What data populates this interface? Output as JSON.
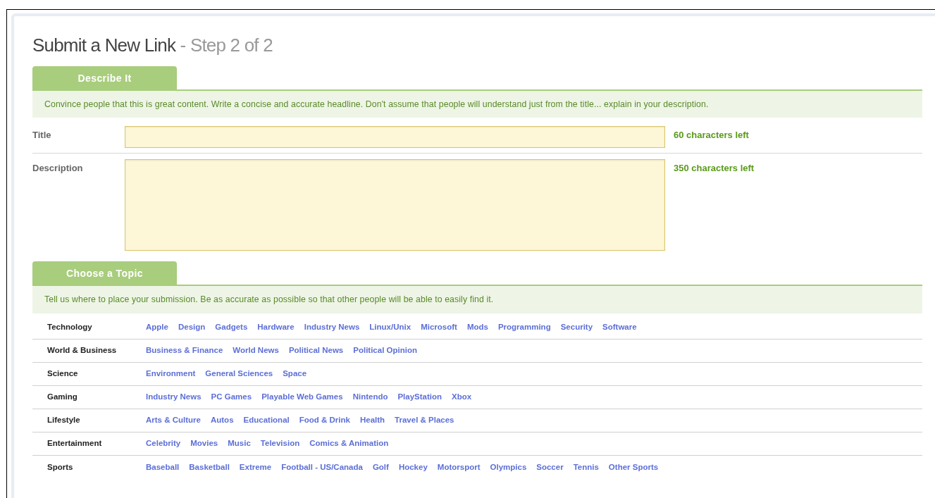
{
  "heading": {
    "title": "Submit a New Link",
    "step": "- Step 2 of 2"
  },
  "describe": {
    "tab": "Describe It",
    "tip": "Convince people that this is great content. Write a concise and accurate headline. Don't assume that people will understand just from the title... explain in your description.",
    "fields": [
      {
        "kind": "line",
        "label": "Title",
        "counter": "60 characters left"
      },
      {
        "kind": "area",
        "label": "Description",
        "counter": "350 characters left"
      }
    ]
  },
  "topic": {
    "tab": "Choose a Topic",
    "tip": "Tell us where to place your submission. Be as accurate as possible so that other people will be able to easily find it.",
    "categories": [
      {
        "name": "Technology",
        "topics": [
          "Apple",
          "Design",
          "Gadgets",
          "Hardware",
          "Industry News",
          "Linux/Unix",
          "Microsoft",
          "Mods",
          "Programming",
          "Security",
          "Software"
        ]
      },
      {
        "name": "World & Business",
        "topics": [
          "Business & Finance",
          "World News",
          "Political News",
          "Political Opinion"
        ]
      },
      {
        "name": "Science",
        "topics": [
          "Environment",
          "General Sciences",
          "Space"
        ]
      },
      {
        "name": "Gaming",
        "topics": [
          "Industry News",
          "PC Games",
          "Playable Web Games",
          "Nintendo",
          "PlayStation",
          "Xbox"
        ]
      },
      {
        "name": "Lifestyle",
        "topics": [
          "Arts & Culture",
          "Autos",
          "Educational",
          "Food & Drink",
          "Health",
          "Travel & Places"
        ]
      },
      {
        "name": "Entertainment",
        "topics": [
          "Celebrity",
          "Movies",
          "Music",
          "Television",
          "Comics & Animation"
        ]
      },
      {
        "name": "Sports",
        "topics": [
          "Baseball",
          "Basketball",
          "Extreme",
          "Football - US/Canada",
          "Golf",
          "Hockey",
          "Motorsport",
          "Olympics",
          "Soccer",
          "Tennis",
          "Other Sports"
        ]
      }
    ]
  }
}
